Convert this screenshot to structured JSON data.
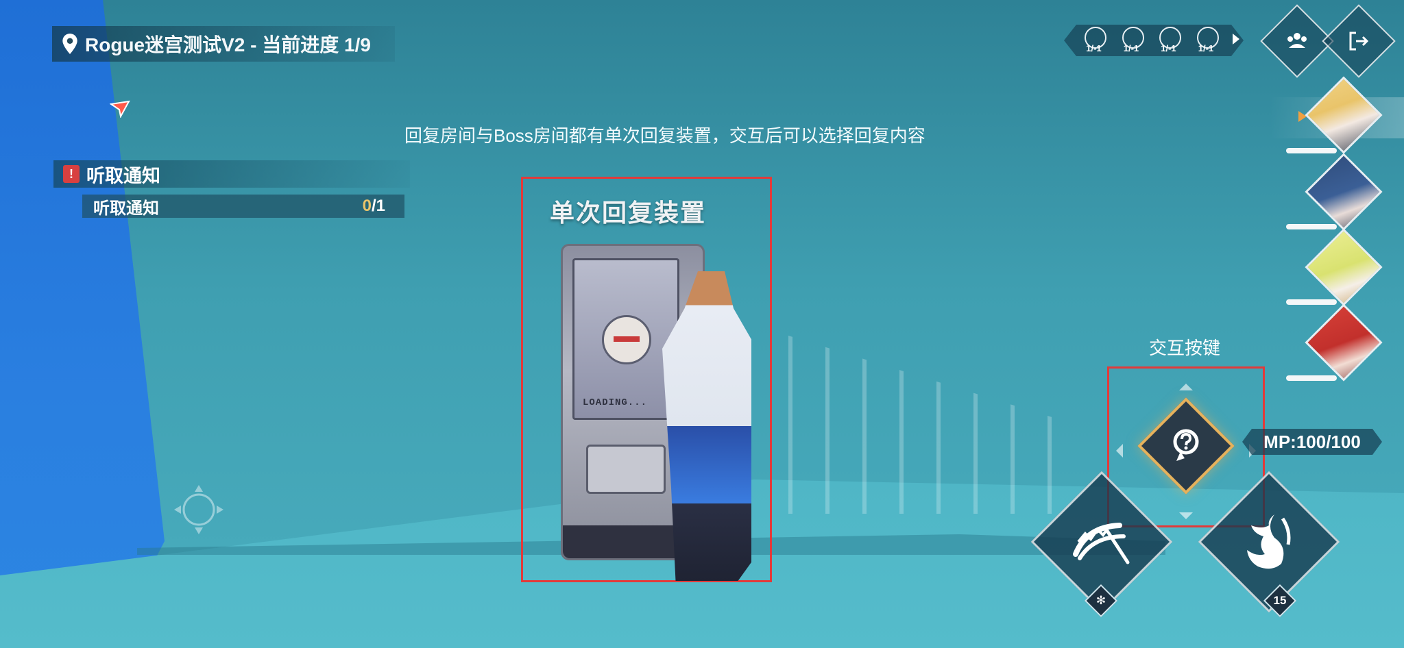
{
  "header": {
    "location_title": "Rogue迷宫测试V2 - 当前进度 1/9"
  },
  "hint": {
    "text": "回复房间与Boss房间都有单次回复装置，交互后可以选择回复内容"
  },
  "quest": {
    "title": "听取通知",
    "badge": "!",
    "objective_label": "听取通知",
    "progress_current": "0",
    "progress_total": "/1"
  },
  "device": {
    "title": "单次回复装置",
    "screen_text": "LOADING..."
  },
  "team_status": [
    {
      "value": "1/-1"
    },
    {
      "value": "1/-1"
    },
    {
      "value": "1/-1"
    },
    {
      "value": "1/-1"
    }
  ],
  "interact": {
    "label": "交互按键"
  },
  "mp": {
    "text": "MP:100/100"
  },
  "skills": {
    "skill1_badge": "✻",
    "skill2_badge": "15"
  },
  "colors": {
    "highlight_box": "#e23a3a",
    "accent_gold": "#e6b25c",
    "hp_bar": "#f4f7f8"
  },
  "icons": {
    "location": "pin-icon",
    "team": "team-icon",
    "exit": "exit-icon",
    "interact": "question-magnifier-icon",
    "skill1": "claw-slash-icon",
    "skill2": "dragon-ultimate-icon"
  }
}
